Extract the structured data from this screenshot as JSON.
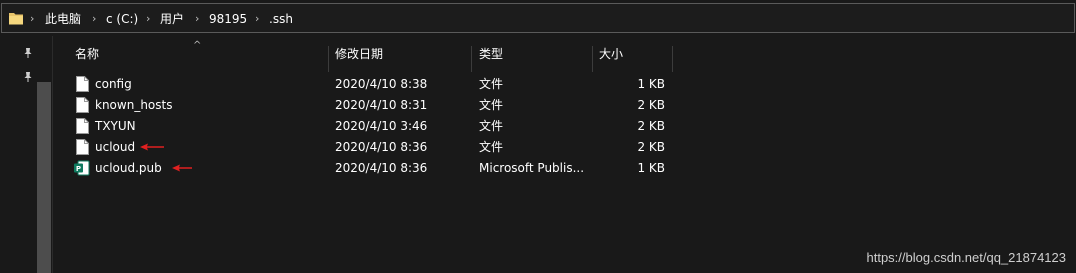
{
  "breadcrumb": {
    "items": [
      "此电脑",
      "c (C:)",
      "用户",
      "98195",
      ".ssh"
    ]
  },
  "columns": {
    "name": "名称",
    "date": "修改日期",
    "type": "类型",
    "size": "大小"
  },
  "files": [
    {
      "name": "config",
      "date": "2020/4/10 8:38",
      "type": "文件",
      "size": "1 KB",
      "icon": "blank-file-icon",
      "marked": false
    },
    {
      "name": "known_hosts",
      "date": "2020/4/10 8:31",
      "type": "文件",
      "size": "2 KB",
      "icon": "blank-file-icon",
      "marked": false
    },
    {
      "name": "TXYUN",
      "date": "2020/4/10 3:46",
      "type": "文件",
      "size": "2 KB",
      "icon": "blank-file-icon",
      "marked": false
    },
    {
      "name": "ucloud",
      "date": "2020/4/10 8:36",
      "type": "文件",
      "size": "2 KB",
      "icon": "blank-file-icon",
      "marked": true
    },
    {
      "name": "ucloud.pub",
      "date": "2020/4/10 8:36",
      "type": "Microsoft Publis...",
      "size": "1 KB",
      "icon": "publisher-file-icon",
      "marked": true
    }
  ],
  "watermark": "https://blog.csdn.net/qq_21874123",
  "colors": {
    "background": "#191919",
    "arrow": "#e02020",
    "publisher": "#0e7a5f"
  }
}
